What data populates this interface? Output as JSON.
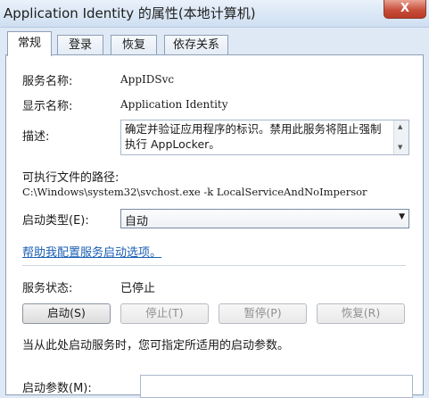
{
  "window": {
    "title": "Application Identity 的属性(本地计算机)",
    "close_label": "X"
  },
  "tabs": [
    {
      "label": "常规"
    },
    {
      "label": "登录"
    },
    {
      "label": "恢复"
    },
    {
      "label": "依存关系"
    }
  ],
  "general": {
    "service_name_label": "服务名称:",
    "service_name_value": "AppIDSvc",
    "display_name_label": "显示名称:",
    "display_name_value": "Application Identity",
    "description_label": "描述:",
    "description_value": "确定并验证应用程序的标识。禁用此服务将阻止强制执行 AppLocker。",
    "path_label": "可执行文件的路径:",
    "path_value": "C:\\Windows\\system32\\svchost.exe -k LocalServiceAndNoImpersor",
    "startup_type_label": "启动类型(E):",
    "startup_type_value": "自动",
    "help_link": "帮助我配置服务启动选项。",
    "status_label": "服务状态:",
    "status_value": "已停止",
    "buttons": {
      "start": "启动(S)",
      "stop": "停止(T)",
      "pause": "暂停(P)",
      "resume": "恢复(R)"
    },
    "hint": "当从此处启动服务时，您可指定所适用的启动参数。",
    "params_label": "启动参数(M):",
    "params_value": ""
  },
  "icons": {
    "combo_arrow": "chevron-down-icon",
    "scroll_up": "scroll-up-icon",
    "scroll_down": "scroll-down-icon"
  }
}
